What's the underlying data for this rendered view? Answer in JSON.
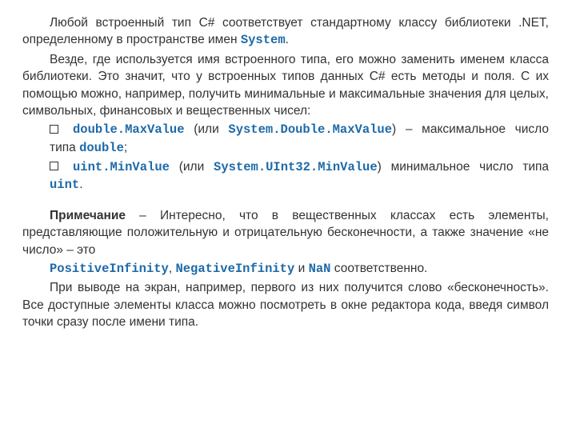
{
  "p1a": "Любой встроенный тип C# соответствует стандартному классу библиотеки .NET, определенному в пространстве имен ",
  "p1b": "System",
  "p1c": ".",
  "p2": "Везде, где используется имя встроенного типа, его можно заменить именем класса библиотеки. Это значит, что у встроенных типов данных C# есть методы и поля. С их помощью можно, например, получить минимальные и максимальные значения для целых, символьных, финансовых и вещественных чисел:",
  "b1a": "double.MaxValue",
  "b1b": " (или ",
  "b1c": "System.Double.MaxValue",
  "b1d": ") – максимальное число типа ",
  "b1e": "double",
  "b1f": ";",
  "b2a": "uint.MinValue",
  "b2b": " (или ",
  "b2c": "System.UInt32.MinValue",
  "b2d": ") минимальное число типа ",
  "b2e": "uint",
  "b2f": ".",
  "noteLabel": "Примечание",
  "note1": " – Интересно, что в вещественных классах есть элементы, представляющие положительную и отрицательную бесконечности, а также значение «не число» – это",
  "n1": "PositiveInfinity",
  "sep1": ", ",
  "n2": "NegativeInfinity",
  "sep2": " и ",
  "n3": "NaN",
  "noteTail": " соответственно.",
  "p3": "При выводе на экран, например, первого из них получится слово «бесконечность». Все доступные элементы класса можно посмотреть в окне редактора кода, введя символ точки сразу после имени типа."
}
